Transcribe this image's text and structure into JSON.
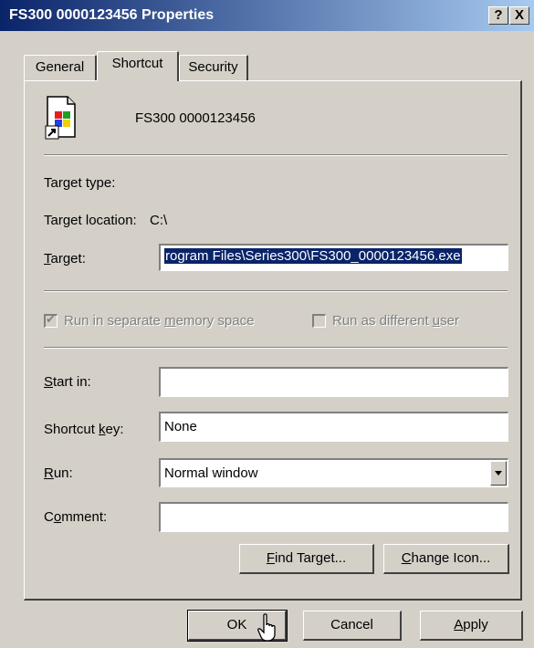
{
  "window": {
    "title": "FS300 0000123456 Properties",
    "help_label": "?",
    "close_label": "X"
  },
  "tabs": [
    {
      "label": "General"
    },
    {
      "label": "Shortcut"
    },
    {
      "label": "Security"
    }
  ],
  "shortcut": {
    "name": "FS300 0000123456",
    "target_type_label": "Target type:",
    "target_location_label": "Target location:",
    "target_location_value": "C:\\",
    "target_label_pre": "",
    "target_label_u": "T",
    "target_label_post": "arget:",
    "target_value": "rogram Files\\Series300\\FS300_0000123456.exe",
    "run_separate_pre": "Run in separate ",
    "run_separate_u": "m",
    "run_separate_post": "emory space",
    "run_separate_checked": "✔",
    "run_different_pre": "Run as different ",
    "run_different_u": "u",
    "run_different_post": "ser",
    "start_in_label_u": "S",
    "start_in_label_post": "tart in:",
    "start_in_value": "",
    "shortcut_key_label_pre": "Shortcut ",
    "shortcut_key_label_u": "k",
    "shortcut_key_label_post": "ey:",
    "shortcut_key_value": "None",
    "run_label_u": "R",
    "run_label_post": "un:",
    "run_value": "Normal window",
    "comment_label_pre": "C",
    "comment_label_u": "o",
    "comment_label_post": "mment:",
    "comment_value": "",
    "find_target_u": "F",
    "find_target_post": "ind Target...",
    "change_icon_u": "C",
    "change_icon_post": "hange Icon..."
  },
  "footer": {
    "ok_label": "OK",
    "cancel_label": "Cancel",
    "apply_u": "A",
    "apply_post": "pply"
  }
}
